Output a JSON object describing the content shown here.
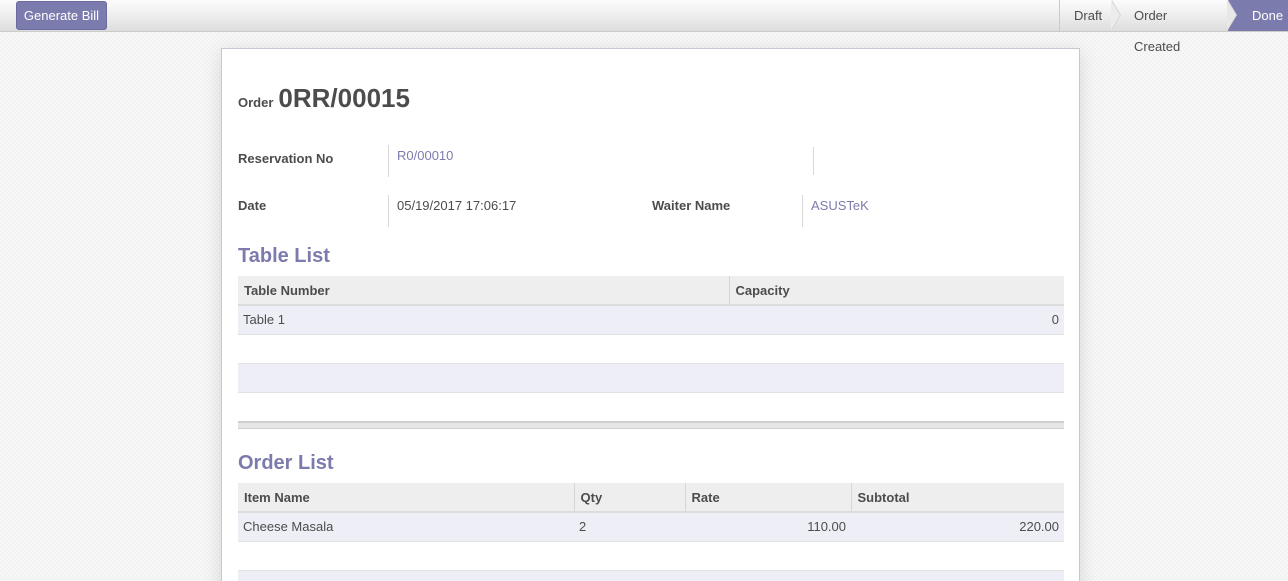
{
  "statusbar": {
    "generate_bill_label": "Generate Bill",
    "stages": [
      {
        "label": "Draft",
        "active": false
      },
      {
        "label": "Order Created",
        "active": false
      },
      {
        "label": "Done",
        "active": true
      }
    ]
  },
  "form": {
    "title_label": "Order",
    "title_value": "0RR/00015",
    "reservation_label": "Reservation No",
    "reservation_value": "R0/00010",
    "date_label": "Date",
    "date_value": "05/19/2017 17:06:17",
    "waiter_label": "Waiter Name",
    "waiter_value": "ASUSTeK"
  },
  "table_list": {
    "title": "Table List",
    "columns": [
      "Table Number",
      "Capacity"
    ],
    "rows": [
      {
        "table_number": "Table 1",
        "capacity": "0"
      }
    ]
  },
  "order_list": {
    "title": "Order List",
    "columns": [
      "Item Name",
      "Qty",
      "Rate",
      "Subtotal"
    ],
    "rows": [
      {
        "item_name": "Cheese Masala",
        "qty": "2",
        "rate": "110.00",
        "subtotal": "220.00"
      }
    ]
  },
  "colors": {
    "accent": "#7c7bad",
    "row_stripe": "#eeeef7",
    "header_bg": "#eeeeee"
  }
}
